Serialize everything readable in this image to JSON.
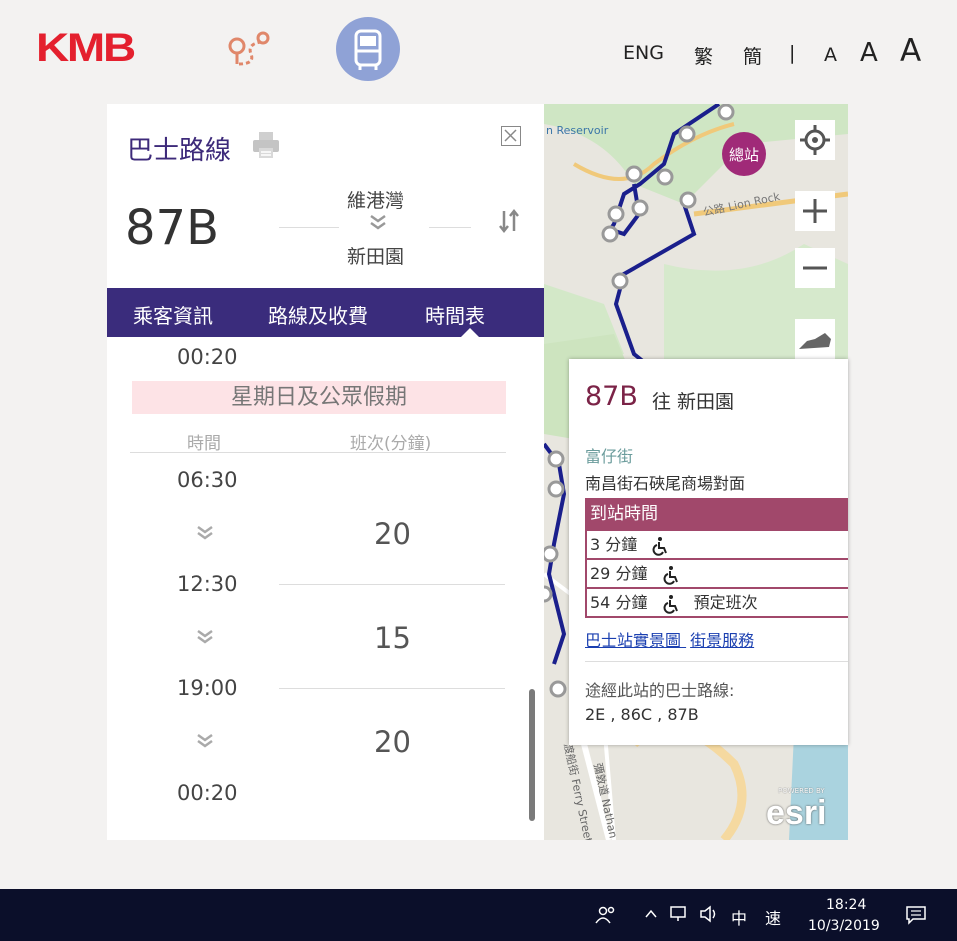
{
  "header": {
    "logo_text": "KMB",
    "languages": [
      "ENG",
      "繁",
      "簡"
    ],
    "separator": "|",
    "font_sizes": [
      "A",
      "A",
      "A"
    ]
  },
  "panel": {
    "title": "巴士路線",
    "route_number": "87B",
    "origin": "維港灣",
    "destination": "新田園",
    "tabs": [
      "乘客資訊",
      "路線及收費",
      "時間表"
    ],
    "active_tab": "時間表",
    "schedule": {
      "prev_time": "00:20",
      "section_title": "星期日及公眾假期",
      "col_time": "時間",
      "col_freq": "班次(分鐘)",
      "rows": [
        {
          "start": "06:30",
          "freq": "20"
        },
        {
          "start": "12:30",
          "freq": "15"
        },
        {
          "start": "19:00",
          "freq": "20"
        }
      ],
      "end_time": "00:20"
    }
  },
  "map": {
    "reservoir_label": "n Reservoir",
    "terminus_label": "總站",
    "road_label_1": "渡船街 Ferry Street",
    "road_label_2": "彌敦道 Nathan R",
    "road_label_3": "公路 Lion Rock",
    "esri_powered": "POWERED BY",
    "esri": "esri",
    "route_color": "#1a1f8c"
  },
  "popup": {
    "route": "87B",
    "direction": "往 新田園",
    "street": "富仔街",
    "stop": "南昌街石硤尾商場對面",
    "eta_header": "到站時間",
    "etas": [
      {
        "text": "3 分鐘",
        "note": ""
      },
      {
        "text": "29 分鐘",
        "note": ""
      },
      {
        "text": "54 分鐘",
        "note": "預定班次"
      }
    ],
    "link_streetview_photo": "巴士站實景圖",
    "link_streetview": "街景服務",
    "via_label": "途經此站的巴士路線:",
    "via_routes": "2E , 86C , 87B"
  },
  "taskbar": {
    "ime_lang": "中",
    "ime_mode": "速",
    "time": "18:24",
    "date": "10/3/2019"
  }
}
